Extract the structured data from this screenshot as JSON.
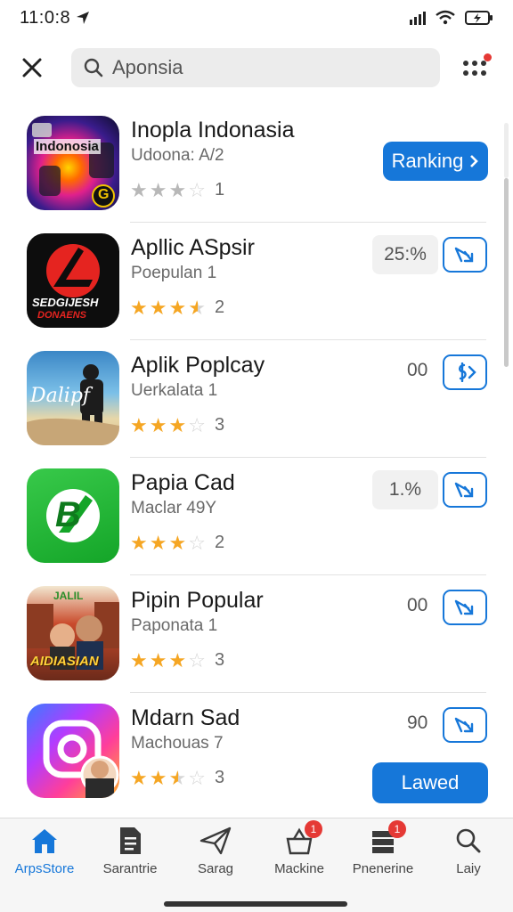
{
  "status_bar": {
    "time": "11:0:8"
  },
  "search": {
    "value": "Aponsia",
    "placeholder": ""
  },
  "apps": [
    {
      "name": "Inopla Indonasia",
      "subtitle": "Udoona: A/2",
      "stars": 3,
      "rating_count": "1",
      "icon_text": "Indonosia",
      "icon_badge": "G",
      "action": "Ranking"
    },
    {
      "name": "Apllic ASpsir",
      "subtitle": "Poepulan 1",
      "stars": 3.5,
      "rating_count": "2",
      "icon_text": "SEDGIJESH",
      "icon_text2": "DONAENS",
      "stat": "25:%"
    },
    {
      "name": "Aplik Poplcay",
      "subtitle": "Uerkalata 1",
      "stars": 3,
      "rating_count": "3",
      "icon_text": "Dalipf",
      "stat": "00"
    },
    {
      "name": "Papia Cad",
      "subtitle": "Maclar 49Y",
      "stars": 3,
      "rating_count": "2",
      "icon_text": "B",
      "stat": "1.%"
    },
    {
      "name": "Pipin Popular",
      "subtitle": "Paponata 1",
      "stars": 3,
      "rating_count": "3",
      "icon_text": "AIDIASIAN",
      "icon_text2": "JALIL",
      "stat": "00"
    },
    {
      "name": "Mdarn Sad",
      "subtitle": "Machouas 7",
      "stars": 2.5,
      "rating_count": "3",
      "stat": "90",
      "action": "Lawed"
    }
  ],
  "nav": [
    {
      "label": "ArpsStore",
      "icon": "home-icon",
      "badge": ""
    },
    {
      "label": "Sarantrie",
      "icon": "document-icon",
      "badge": ""
    },
    {
      "label": "Sarag",
      "icon": "send-icon",
      "badge": ""
    },
    {
      "label": "Mackine",
      "icon": "bag-icon",
      "badge": "1"
    },
    {
      "label": "Pnenerine",
      "icon": "stack-icon",
      "badge": "1"
    },
    {
      "label": "Laiy",
      "icon": "search-icon",
      "badge": ""
    }
  ],
  "colors": {
    "accent": "#1677d9",
    "star": "#f5a623",
    "badge": "#e53935"
  }
}
